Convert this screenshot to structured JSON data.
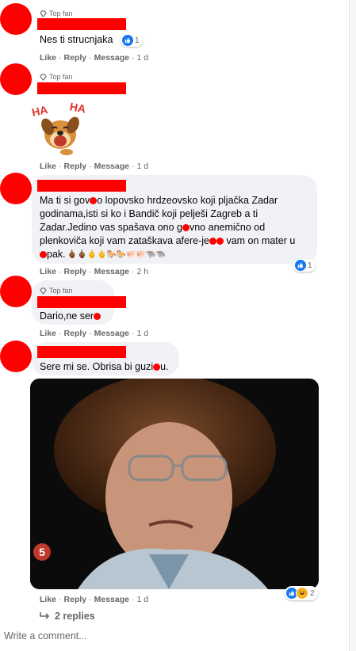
{
  "colors": {
    "redaction": "#ff0000",
    "bubble": "#f0f2f5",
    "link": "#65676b",
    "like_blue": "#1877f2"
  },
  "comments": [
    {
      "badge": "Top fan",
      "text": "Nes ti strucnjaka",
      "reaction_count": "1",
      "actions": {
        "like": "Like",
        "reply": "Reply",
        "message": "Message",
        "time": "1 d"
      }
    },
    {
      "badge": "Top fan",
      "sticker_text_left": "HA",
      "sticker_text_right": "HA",
      "actions": {
        "like": "Like",
        "reply": "Reply",
        "message": "Message",
        "time": "1 d"
      }
    },
    {
      "lines": [
        "Ma ti si gov●o lopovsko hrdzeovsko koji pljačka Zadar",
        "godinama,isti si ko i Bandič koji pelješi Zagreb a ti",
        "Zadar.Jedino vas spašava ono g●vno anemično od",
        "plenkoviča koji vam zataškava afere-je●● vam on mater u"
      ],
      "last_line": "●pak.",
      "emojis": "🖕🏾🖕🏾🖕🖕🐎🐎🐖🐖🐃🐃",
      "reaction_count": "1",
      "actions": {
        "like": "Like",
        "reply": "Reply",
        "message": "Message",
        "time": "2 h"
      }
    },
    {
      "badge": "Top fan",
      "text": "Dario,ne ser●",
      "actions": {
        "like": "Like",
        "reply": "Reply",
        "message": "Message",
        "time": "1 d"
      }
    },
    {
      "text": "Sere mi se. Obrisa bi guzi●u.",
      "reaction_count": "2",
      "gif_logo": "5",
      "actions": {
        "like": "Like",
        "reply": "Reply",
        "message": "Message",
        "time": "1 d"
      }
    }
  ],
  "replies_label": "2 replies",
  "write_comment_placeholder": "Write a comment..."
}
